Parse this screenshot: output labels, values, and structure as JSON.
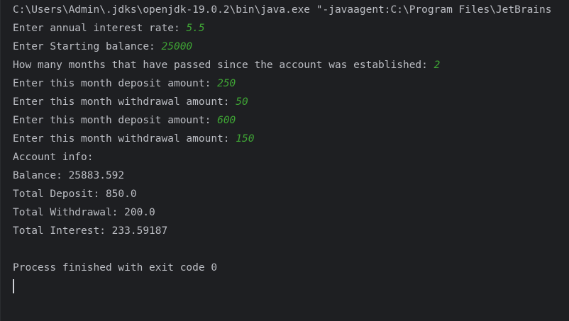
{
  "console": {
    "command_line": "C:\\Users\\Admin\\.jdks\\openjdk-19.0.2\\bin\\java.exe \"-javaagent:C:\\Program Files\\JetBrains",
    "prompts": [
      {
        "text": "Enter annual interest rate: ",
        "input": "5.5"
      },
      {
        "text": "Enter Starting balance: ",
        "input": "25000"
      },
      {
        "text": "How many months that have passed since the account was established: ",
        "input": "2"
      },
      {
        "text": "Enter this month deposit amount: ",
        "input": "250"
      },
      {
        "text": "Enter this month withdrawal amount: ",
        "input": "50"
      },
      {
        "text": "Enter this month deposit amount: ",
        "input": "600"
      },
      {
        "text": "Enter this month withdrawal amount: ",
        "input": "150"
      }
    ],
    "output": [
      "Account info:",
      "Balance: 25883.592",
      "Total Deposit: 850.0",
      "Total Withdrawal: 200.0",
      "Total Interest: 233.59187"
    ],
    "exit_message": "Process finished with exit code 0",
    "colors": {
      "background": "#1e1f22",
      "text": "#bcbec4",
      "user_input": "#3fa535"
    }
  }
}
